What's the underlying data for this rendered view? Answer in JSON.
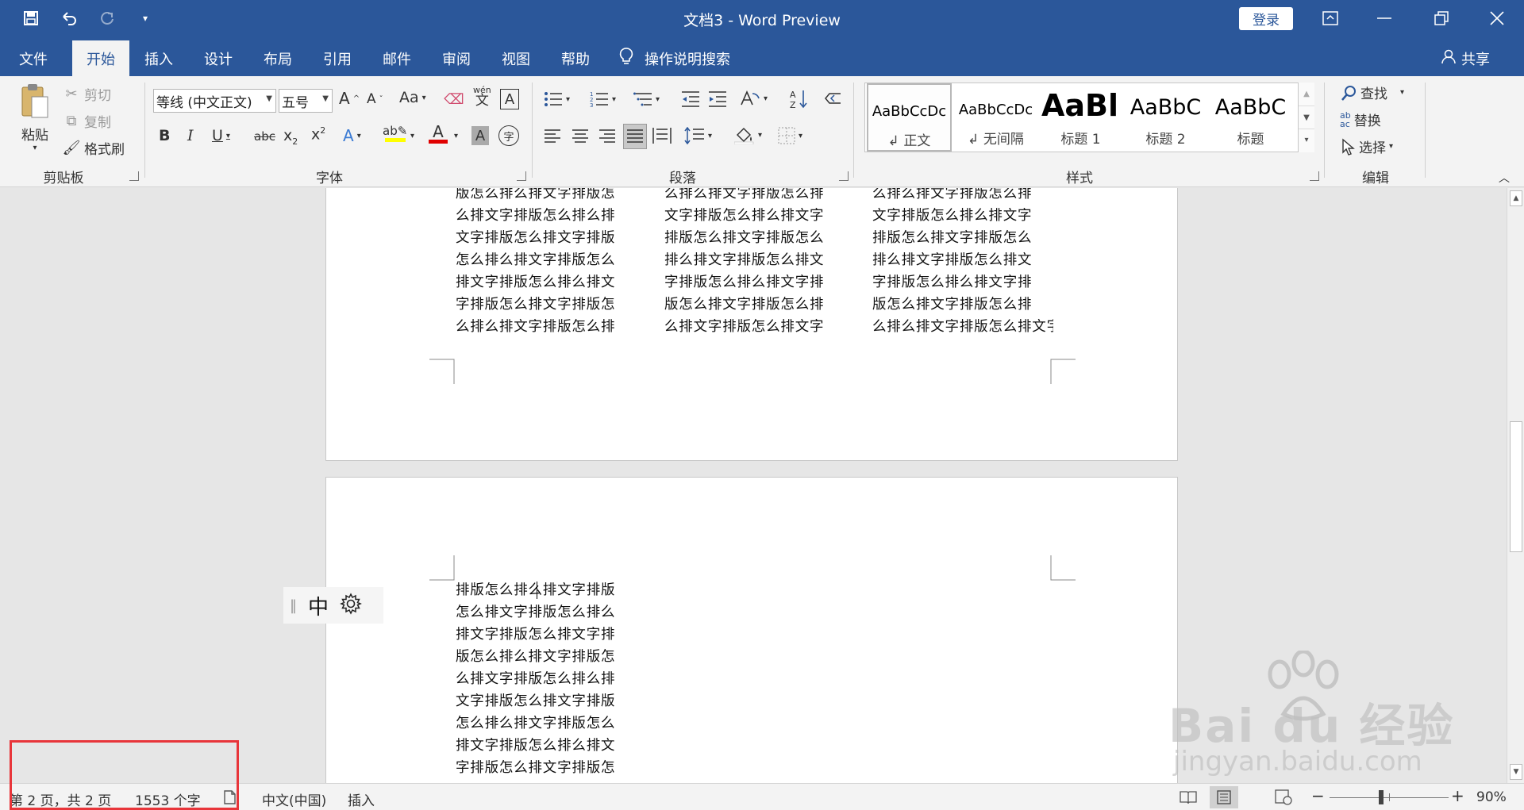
{
  "window": {
    "title": "文档3  -  Word Preview",
    "login_label": "登录"
  },
  "tabs": [
    "文件",
    "开始",
    "插入",
    "设计",
    "布局",
    "引用",
    "邮件",
    "审阅",
    "视图",
    "帮助"
  ],
  "tell_me": "操作说明搜索",
  "share_label": "共享",
  "clipboard": {
    "paste": "粘贴",
    "cut": "剪切",
    "copy": "复制",
    "format_painter": "格式刷",
    "label": "剪贴板"
  },
  "font": {
    "name": "等线 (中文正文)",
    "size": "五号",
    "label": "字体",
    "bold": "B",
    "italic": "I",
    "underline": "U",
    "strike": "abc",
    "grow": "A",
    "shrink": "A",
    "case": "Aa",
    "phonetic": "wén",
    "phonetic_char": "文",
    "border_char": "A",
    "effect": "A",
    "color": "A",
    "shade": "A",
    "enclose": "字"
  },
  "paragraph": {
    "label": "段落"
  },
  "styles": {
    "label": "样式",
    "items": [
      {
        "sample": "AaBbCcDc",
        "name": "↲ 正文"
      },
      {
        "sample": "AaBbCcDc",
        "name": "↲ 无间隔"
      },
      {
        "sample": "AaBl",
        "name": "标题 1"
      },
      {
        "sample": "AaBbC",
        "name": "标题 2"
      },
      {
        "sample": "AaBbC",
        "name": "标题"
      }
    ]
  },
  "editing": {
    "label": "编辑",
    "find": "查找",
    "replace": "替换",
    "select": "选择"
  },
  "page1": {
    "col1": [
      "版怎么排么排文字排版怎",
      "么排文字排版怎么排么排",
      "文字排版怎么排文字排版",
      "怎么排么排文字排版怎么",
      "排文字排版怎么排么排文",
      "字排版怎么排文字排版怎",
      "么排么排文字排版怎么排"
    ],
    "col2": [
      "么排么排文字排版怎么排",
      "文字排版怎么排么排文字",
      "排版怎么排文字排版怎么",
      "排么排文字排版怎么排文",
      "字排版怎么排么排文字排",
      "版怎么排文字排版怎么排",
      "么排文字排版怎么排文字"
    ],
    "col3": [
      "么排么排文字排版怎么排",
      "文字排版怎么排么排文字",
      "排版怎么排文字排版怎么",
      "排么排文字排版怎么排文",
      "字排版怎么排么排文字排",
      "版怎么排文字排版怎么排",
      "么排么排文字排版怎么排文字"
    ]
  },
  "page2": {
    "col1": [
      "排版怎么排么排文字排版",
      "怎么排文字排版怎么排么",
      "排文字排版怎么排文字排",
      "版怎么排么排文字排版怎",
      "么排文字排版怎么排么排",
      "文字排版怎么排文字排版",
      "怎么排么排文字排版怎么",
      "排文字排版怎么排么排文",
      "字排版怎么排文字排版怎"
    ]
  },
  "ime": {
    "mode": "中"
  },
  "status": {
    "page": "第 2 页，共 2 页",
    "words": "1553 个字",
    "language": "中文(中国)",
    "mode": "插入",
    "zoom": "90%"
  },
  "watermark": {
    "brand": "Bai du 经验",
    "url": "jingyan.baidu.com"
  }
}
